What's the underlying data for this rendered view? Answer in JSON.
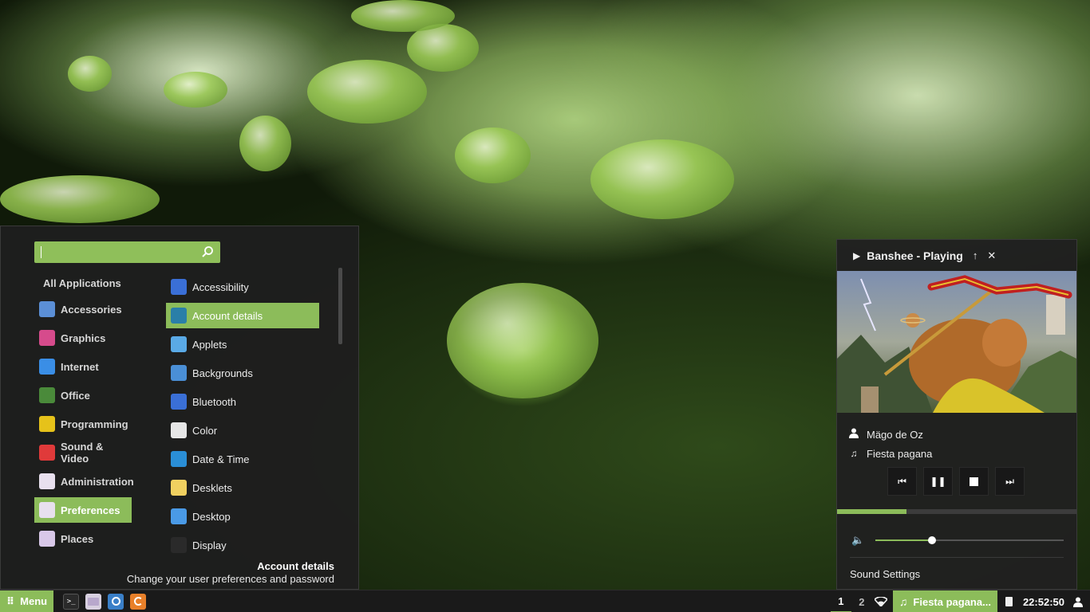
{
  "menu": {
    "search": {
      "value": "",
      "placeholder": ""
    },
    "categories_heading": "All Applications",
    "categories": [
      {
        "label": "Accessories",
        "icon": "scissors-icon",
        "color": "#5b8fd6"
      },
      {
        "label": "Graphics",
        "icon": "palette-icon",
        "color": "#d64b8c"
      },
      {
        "label": "Internet",
        "icon": "cloud-icon",
        "color": "#3a8ee6"
      },
      {
        "label": "Office",
        "icon": "document-icon",
        "color": "#4a8a3a"
      },
      {
        "label": "Programming",
        "icon": "code-icon",
        "color": "#e6c21a"
      },
      {
        "label": "Sound & Video",
        "icon": "play-icon",
        "color": "#e03a3a"
      },
      {
        "label": "Administration",
        "icon": "sliders-icon",
        "color": "#e8e0ee"
      },
      {
        "label": "Preferences",
        "icon": "sliders-icon",
        "color": "#e8e0ee"
      },
      {
        "label": "Places",
        "icon": "folder-icon",
        "color": "#d8c8e8"
      }
    ],
    "active_category": "Preferences",
    "apps": [
      {
        "label": "Accessibility",
        "icon": "accessibility-icon",
        "color": "#3a6fd6"
      },
      {
        "label": "Account details",
        "icon": "user-icon",
        "color": "#2a7fa8"
      },
      {
        "label": "Applets",
        "icon": "applets-icon",
        "color": "#5aaae6"
      },
      {
        "label": "Backgrounds",
        "icon": "image-icon",
        "color": "#4a8fd6"
      },
      {
        "label": "Bluetooth",
        "icon": "bluetooth-icon",
        "color": "#3a6fd6"
      },
      {
        "label": "Color",
        "icon": "color-icon",
        "color": "#e6e6e6"
      },
      {
        "label": "Date & Time",
        "icon": "clock-icon",
        "color": "#2a8ed6"
      },
      {
        "label": "Desklets",
        "icon": "desklet-icon",
        "color": "#f0d060"
      },
      {
        "label": "Desktop",
        "icon": "desktop-icon",
        "color": "#4a9ae6"
      },
      {
        "label": "Display",
        "icon": "display-icon",
        "color": "#2a2a2a"
      }
    ],
    "active_app": "Account details",
    "description": {
      "title": "Account details",
      "text": "Change your user preferences and password"
    }
  },
  "player": {
    "title": "Banshee - Playing",
    "artist": "Mägo de Oz",
    "track": "Fiesta pagana",
    "progress_fraction": 0.29,
    "volume_fraction": 0.3,
    "sound_settings_label": "Sound Settings"
  },
  "panel": {
    "menu_label": "Menu",
    "workspaces": [
      "1",
      "2"
    ],
    "active_workspace": "1",
    "now_playing": "Fiesta pagana...",
    "clock": "22:52:50",
    "accent": "#8cbc5a"
  }
}
